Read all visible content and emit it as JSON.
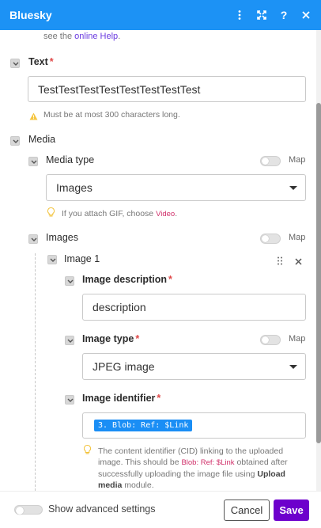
{
  "window": {
    "title": "Bluesky",
    "icons": [
      "more-vertical-icon",
      "expand-icon",
      "help-icon",
      "close-icon"
    ]
  },
  "help": {
    "prefix": "see the ",
    "link": "online Help",
    "suffix": "."
  },
  "text_field": {
    "label": "Text",
    "required": "*",
    "value": "TestTestTestTestTestTestTestTest",
    "warning": "Must be at most 300 characters long."
  },
  "media": {
    "label": "Media",
    "media_type": {
      "label": "Media type",
      "map_label": "Map",
      "value": "Images",
      "note_prefix": "If you attach GIF, choose ",
      "note_code": "Video",
      "note_suffix": "."
    },
    "images": {
      "label": "Images",
      "map_label": "Map",
      "item": {
        "label": "Image 1",
        "description": {
          "label": "Image description",
          "required": "*",
          "value": "description"
        },
        "image_type": {
          "label": "Image type",
          "required": "*",
          "map_label": "Map",
          "value": "JPEG image"
        },
        "identifier": {
          "label": "Image identifier",
          "required": "*",
          "pill": "3. Blob: Ref: $Link",
          "note_1": "The content identifier (CID) linking to the uploaded image. This should be ",
          "note_code": "Blob: Ref: $Link",
          "note_2": " obtained after successfully uploading the image file using ",
          "note_bold": "Upload media",
          "note_3": " module."
        }
      }
    }
  },
  "footer": {
    "advanced_label": "Show advanced settings",
    "cancel": "Cancel",
    "save": "Save"
  },
  "colors": {
    "titlebar": "#1c92f5",
    "save": "#6d00cc",
    "pill": "#1a8ef5",
    "required": "#e04848"
  }
}
